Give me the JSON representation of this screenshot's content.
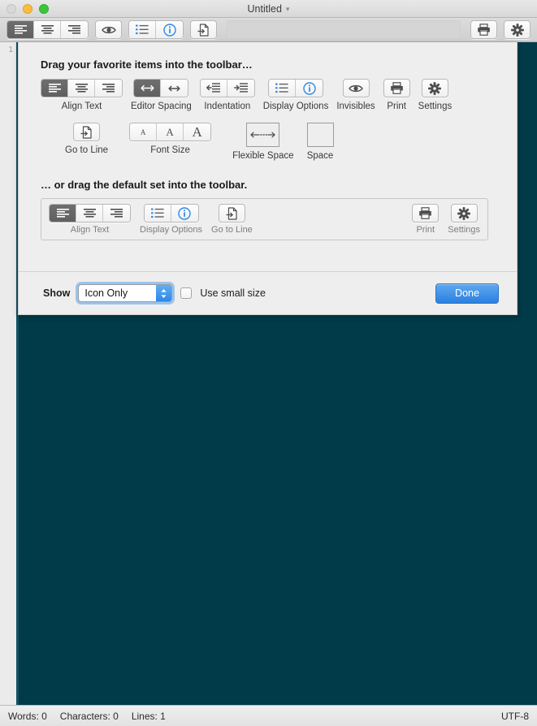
{
  "window": {
    "title": "Untitled",
    "title_chevron": "chevron-down",
    "traffic_lights": [
      "close",
      "minimize",
      "zoom"
    ]
  },
  "toolbar": {
    "align_group": {
      "name": "Align Text",
      "buttons": [
        "align-left",
        "align-center",
        "align-right"
      ],
      "selected_index": 0
    },
    "invisibles_button": "eye-icon",
    "display_options": [
      "list-numbered-icon",
      "info-circle-icon"
    ],
    "go_to_line_button": "goto-line-icon",
    "flexible_space": "",
    "print_button": "printer-icon",
    "settings_button": "gear-icon"
  },
  "sheet": {
    "heading_favorites": "Drag your favorite items into the toolbar…",
    "heading_default": "… or drag the default set into the toolbar.",
    "palette_row1": [
      {
        "label": "Align Text",
        "icons": [
          "align-left",
          "align-center",
          "align-right"
        ],
        "selected_index": 0,
        "type": "segmented"
      },
      {
        "label": "Editor Spacing",
        "icons": [
          "arrows-horizontal",
          "arrows-horizontal-small"
        ],
        "selected_index": 0,
        "type": "segmented"
      },
      {
        "label": "Indentation",
        "icons": [
          "outdent",
          "indent"
        ],
        "selected_index": -1,
        "type": "segmented"
      },
      {
        "label": "Display Options",
        "icons": [
          "list-numbered-icon",
          "info-circle-icon"
        ],
        "selected_index": -1,
        "type": "segmented"
      },
      {
        "label": "Invisibles",
        "icons": [
          "eye-icon"
        ],
        "selected_index": -1,
        "type": "single"
      },
      {
        "label": "Print",
        "icons": [
          "printer-icon"
        ],
        "selected_index": -1,
        "type": "single"
      },
      {
        "label": "Settings",
        "icons": [
          "gear-icon"
        ],
        "selected_index": -1,
        "type": "single"
      }
    ],
    "palette_row2": [
      {
        "label": "Go to Line",
        "icons": [
          "goto-line-icon"
        ],
        "type": "single"
      },
      {
        "label": "Font Size",
        "icons": [
          "font-size-small",
          "font-size-medium",
          "font-size-large"
        ],
        "type": "segmented"
      },
      {
        "label": "Flexible Space",
        "icons": [
          "flexible-space-icon"
        ],
        "type": "box"
      },
      {
        "label": "Space",
        "icons": [
          "space-icon"
        ],
        "type": "box"
      }
    ],
    "default_set": [
      {
        "label": "Align Text",
        "icons": [
          "align-left",
          "align-center",
          "align-right"
        ],
        "selected_index": 0,
        "type": "segmented"
      },
      {
        "label": "Display Options",
        "icons": [
          "list-numbered-icon",
          "info-circle-icon"
        ],
        "type": "segmented"
      },
      {
        "label": "Go to Line",
        "icons": [
          "goto-line-icon"
        ],
        "type": "single"
      }
    ],
    "default_set_right": [
      {
        "label": "Print",
        "icons": [
          "printer-icon"
        ],
        "type": "single"
      },
      {
        "label": "Settings",
        "icons": [
          "gear-icon"
        ],
        "type": "single"
      }
    ],
    "controls": {
      "show_label": "Show",
      "show_value": "Icon Only",
      "show_options": [
        "Icon Only"
      ],
      "small_size_label": "Use small size",
      "small_size_checked": false,
      "done_label": "Done"
    }
  },
  "editor": {
    "line_number": "1",
    "background_color": "#013a49"
  },
  "status": {
    "words": "Words: 0",
    "characters": "Characters: 0",
    "lines": "Lines: 1",
    "encoding": "UTF-8"
  },
  "colors": {
    "accent_blue": "#2c7fe0",
    "editor_bg": "#013a49",
    "sheet_bg": "#efeeee"
  }
}
